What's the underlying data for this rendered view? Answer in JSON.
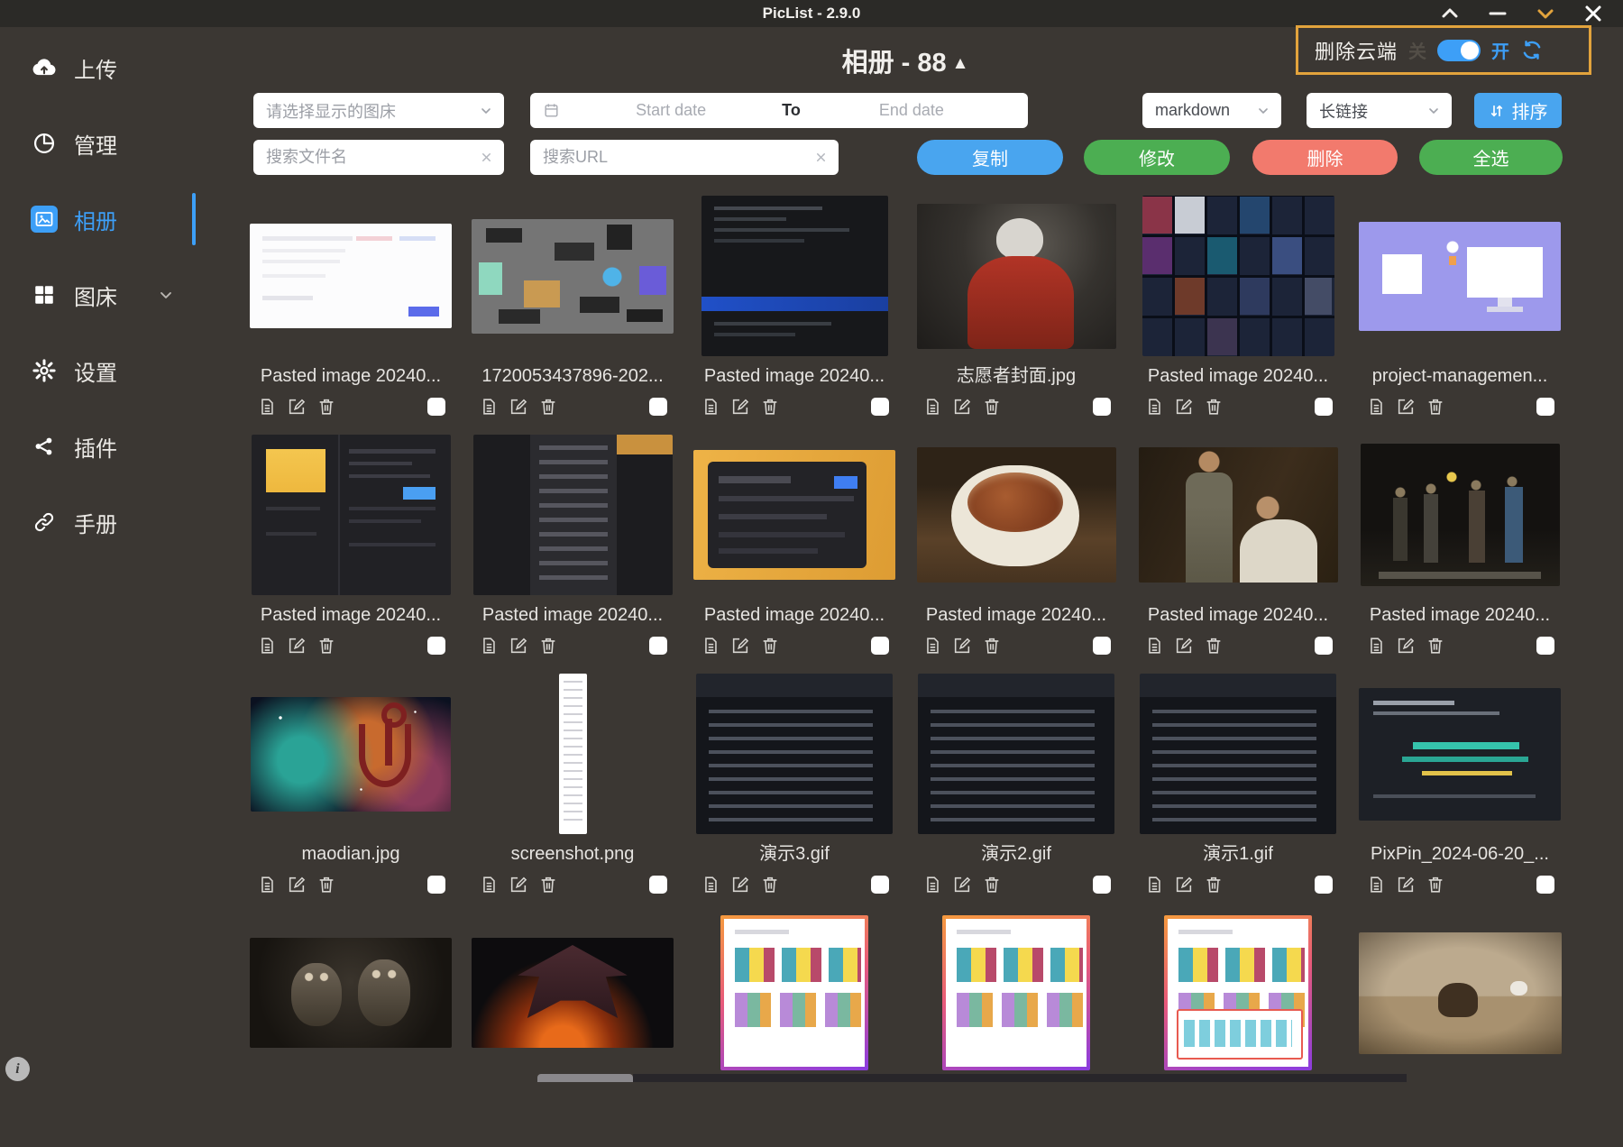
{
  "window": {
    "title": "PicList - 2.9.0",
    "controls": [
      "chevron-up",
      "minimize",
      "chevron-down",
      "close"
    ]
  },
  "header": {
    "title": "相册 - 88",
    "collapse_icon": "▲"
  },
  "cloud_delete": {
    "label": "删除云端",
    "off_label": "关",
    "on_label": "开",
    "state": "on",
    "accent_border": "#e2a33c"
  },
  "sidebar": [
    {
      "label": "上传",
      "icon": "cloud-upload-icon",
      "active": false
    },
    {
      "label": "管理",
      "icon": "pie-chart-icon",
      "active": false
    },
    {
      "label": "相册",
      "icon": "picture-icon",
      "active": true
    },
    {
      "label": "图床",
      "icon": "grid-icon",
      "active": false,
      "has_chevron": true
    },
    {
      "label": "设置",
      "icon": "gear-icon",
      "active": false
    },
    {
      "label": "插件",
      "icon": "share-icon",
      "active": false
    },
    {
      "label": "手册",
      "icon": "link-icon",
      "active": false
    }
  ],
  "filters": {
    "picbed_placeholder": "请选择显示的图床",
    "date_start_placeholder": "Start date",
    "date_separator": "To",
    "date_end_placeholder": "End date",
    "format_value": "markdown",
    "link_type_value": "长链接",
    "sort_label": "排序",
    "search_name_placeholder": "搜索文件名",
    "search_url_placeholder": "搜索URL"
  },
  "actions": {
    "copy": "复制",
    "modify": "修改",
    "delete": "删除",
    "select_all": "全选"
  },
  "colors": {
    "accent_blue": "#49a5ef",
    "accent_green": "#4cae52",
    "accent_red": "#f27a6d",
    "highlight_orange": "#e2a33c"
  },
  "gallery": {
    "items": [
      {
        "name": "Pasted image 20240...",
        "alt": "white-webpage-screenshot"
      },
      {
        "name": "1720053437896-202...",
        "alt": "node-graph-workflow-screenshot"
      },
      {
        "name": "Pasted image 20240...",
        "alt": "dark-code-editor-screenshot"
      },
      {
        "name": "志愿者封面.jpg",
        "alt": "person-white-hair-red-jacket-photo"
      },
      {
        "name": "Pasted image 20240...",
        "alt": "movie-poster-grid-screenshot"
      },
      {
        "name": "project-managemen...",
        "alt": "purple-project-management-illustration"
      },
      {
        "name": "Pasted image 20240...",
        "alt": "dark-settings-ui-screenshot"
      },
      {
        "name": "Pasted image 20240...",
        "alt": "language-list-dropdown-screenshot"
      },
      {
        "name": "Pasted image 20240...",
        "alt": "share-dialog-on-yellow-screenshot"
      },
      {
        "name": "Pasted image 20240...",
        "alt": "bowl-of-braised-pork-rice-photo"
      },
      {
        "name": "Pasted image 20240...",
        "alt": "two-men-film-still-photo"
      },
      {
        "name": "Pasted image 20240...",
        "alt": "dark-alley-group-film-still-photo"
      },
      {
        "name": "maodian.jpg",
        "alt": "nebula-anchor-artwork"
      },
      {
        "name": "screenshot.png",
        "alt": "tall-narrow-page-screenshot"
      },
      {
        "name": "演示3.gif",
        "alt": "dark-ui-demo-gif"
      },
      {
        "name": "演示2.gif",
        "alt": "dark-ui-demo-gif"
      },
      {
        "name": "演示1.gif",
        "alt": "dark-ui-demo-gif"
      },
      {
        "name": "PixPin_2024-06-20_...",
        "alt": "dark-slide-with-teal-text"
      },
      {
        "name": "",
        "alt": "two-owl-creatures-photo"
      },
      {
        "name": "",
        "alt": "dragon-with-fire-artwork"
      },
      {
        "name": "",
        "alt": "book-covers-page-gradient-border"
      },
      {
        "name": "",
        "alt": "book-covers-page-gradient-border"
      },
      {
        "name": "",
        "alt": "book-covers-page-gradient-border"
      },
      {
        "name": "",
        "alt": "cat-on-beach-photo"
      }
    ]
  }
}
